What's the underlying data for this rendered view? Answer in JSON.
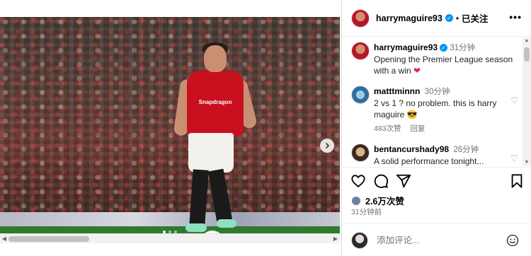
{
  "post": {
    "username": "harrymaguire93",
    "follow_status": "已关注",
    "more_label": "•••"
  },
  "media": {
    "sponsor_text": "Snapdragon",
    "carousel_total": 3,
    "carousel_active": 1
  },
  "comments": [
    {
      "username": "harrymaguire93",
      "time": "31分钟",
      "text": "Opening the Premier League season with a win",
      "emoji": "❤"
    },
    {
      "username": "matttminnn",
      "time": "30分钟",
      "text": "2 vs 1 ? no problem. this is harry maguire",
      "emoji": "😎",
      "likes": "483次赞",
      "reply": "回复"
    },
    {
      "username": "bentancurshady98",
      "time": "26分钟",
      "text": "A solid performance tonight..."
    }
  ],
  "likes": {
    "count": "2.6万次赞"
  },
  "posted_time": "31分钟前",
  "composer": {
    "placeholder": "添加评论..."
  },
  "colors": {
    "verified": "#0095f6",
    "shirt": "#c8101e",
    "muted": "#737373"
  },
  "icons": [
    "verified-icon",
    "more-icon",
    "heart-icon",
    "comment-icon",
    "share-icon",
    "bookmark-icon",
    "emoji-icon",
    "next-icon"
  ]
}
